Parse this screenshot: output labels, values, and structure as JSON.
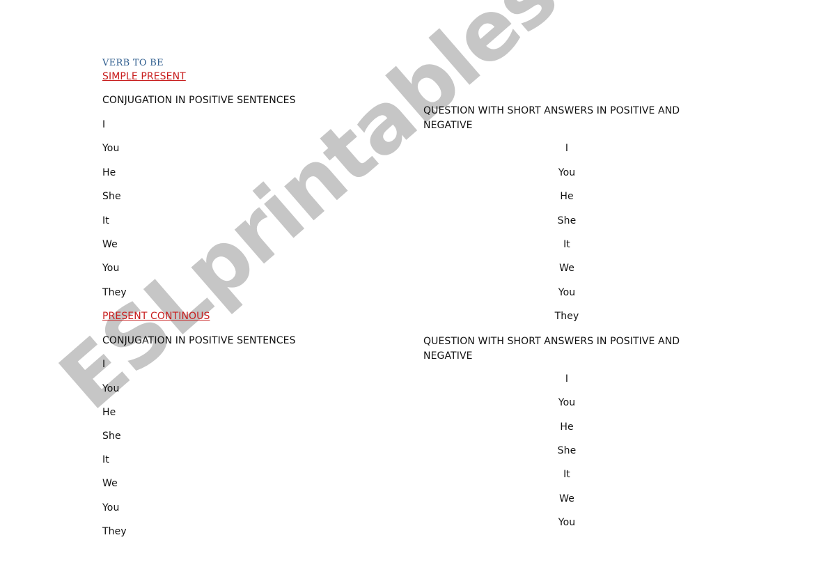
{
  "document": {
    "title": "VERB TO BE",
    "watermark": "ESLprintables.com",
    "colors": {
      "title": "#2e5d8e",
      "section_heading": "#c81e1e",
      "text": "#111111",
      "watermark": "#c6c6c6"
    },
    "sections": [
      {
        "heading": "SIMPLE PRESENT",
        "left": {
          "heading": "CONJUGATION IN POSITIVE SENTENCES",
          "pronouns": [
            "I",
            "You",
            "He",
            "She",
            "It",
            "We",
            "You",
            "They"
          ]
        },
        "right": {
          "heading": "QUESTION WITH SHORT ANSWERS IN POSITIVE AND NEGATIVE",
          "pronouns": [
            "I",
            "You",
            "He",
            "She",
            "It",
            "We",
            "You",
            "They"
          ]
        }
      },
      {
        "heading": "PRESENT CONTINOUS",
        "left": {
          "heading": "CONJUGATION IN POSITIVE SENTENCES",
          "pronouns": [
            "I",
            "You",
            "He",
            "She",
            "It",
            "We",
            "You",
            "They"
          ]
        },
        "right": {
          "heading": "QUESTION WITH SHORT ANSWERS IN POSITIVE AND NEGATIVE",
          "pronouns": [
            "I",
            "You",
            "He",
            "She",
            "It",
            "We",
            "You"
          ]
        }
      }
    ]
  }
}
